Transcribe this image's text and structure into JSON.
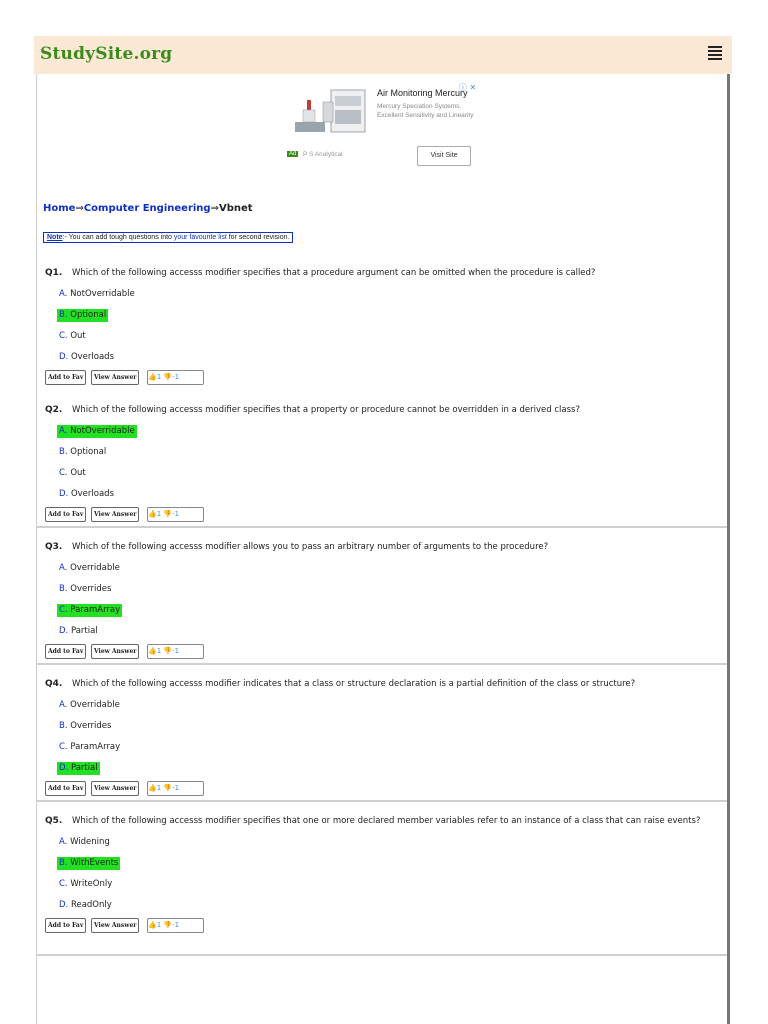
{
  "header": {
    "logo": "StudySite.org"
  },
  "ad": {
    "title": "Air Monitoring Mercury",
    "description": "Mercury Speciation Systems. Excellent Sensitivity and Linearity",
    "controls": "ⓘ ✕",
    "badge": "Ad",
    "sponsor": "P S Analytical",
    "button": "Visit Site"
  },
  "breadcrumb": {
    "home": "Home",
    "sep": "⇒",
    "category": "Computer Engineering",
    "current": "Vbnet"
  },
  "note": {
    "label": "Note",
    "text_before": ":- You can add tough questions into ",
    "link": "your favourite list",
    "text_after": " for second revision."
  },
  "action_labels": {
    "fav": "Add to Fav",
    "view": "View Answer",
    "vote": "👍1 👎-1"
  },
  "questions": [
    {
      "num": "Q1.",
      "text": "Which of the following accesss modifier specifies that a procedure argument can be omitted when the procedure is called?",
      "options": [
        {
          "letter": "A.",
          "text": "NotOverridable"
        },
        {
          "letter": "B.",
          "text": "Optional"
        },
        {
          "letter": "C.",
          "text": "Out"
        },
        {
          "letter": "D.",
          "text": "Overloads"
        }
      ]
    },
    {
      "num": "Q2.",
      "text": "Which of the following accesss modifier specifies that a property or procedure cannot be overridden in a derived class?",
      "options": [
        {
          "letter": "A.",
          "text": "NotOverridable"
        },
        {
          "letter": "B.",
          "text": "Optional"
        },
        {
          "letter": "C.",
          "text": "Out"
        },
        {
          "letter": "D.",
          "text": "Overloads"
        }
      ]
    },
    {
      "num": "Q3.",
      "text": "Which of the following accesss modifier allows you to pass an arbitrary number of arguments to the procedure?",
      "options": [
        {
          "letter": "A.",
          "text": "Overridable"
        },
        {
          "letter": "B.",
          "text": "Overrides"
        },
        {
          "letter": "C.",
          "text": "ParamArray"
        },
        {
          "letter": "D.",
          "text": "Partial"
        }
      ]
    },
    {
      "num": "Q4.",
      "text": "Which of the following accesss modifier indicates that a class or structure declaration is a partial definition of the class or structure?",
      "options": [
        {
          "letter": "A.",
          "text": "Overridable"
        },
        {
          "letter": "B.",
          "text": "Overrides"
        },
        {
          "letter": "C.",
          "text": "ParamArray"
        },
        {
          "letter": "D.",
          "text": "Partial"
        }
      ]
    },
    {
      "num": "Q5.",
      "text": "Which of the following accesss modifier specifies that one or more declared member variables refer to an instance of a class that can raise events?",
      "options": [
        {
          "letter": "A.",
          "text": "Widening"
        },
        {
          "letter": "B.",
          "text": "WithEvents"
        },
        {
          "letter": "C.",
          "text": "WriteOnly"
        },
        {
          "letter": "D.",
          "text": "ReadOnly"
        }
      ]
    }
  ],
  "colors": {
    "correct_highlight": "#22e022",
    "link": "#1030c0",
    "header_bg": "#fbe9d6",
    "logo": "#3a8c1a"
  }
}
